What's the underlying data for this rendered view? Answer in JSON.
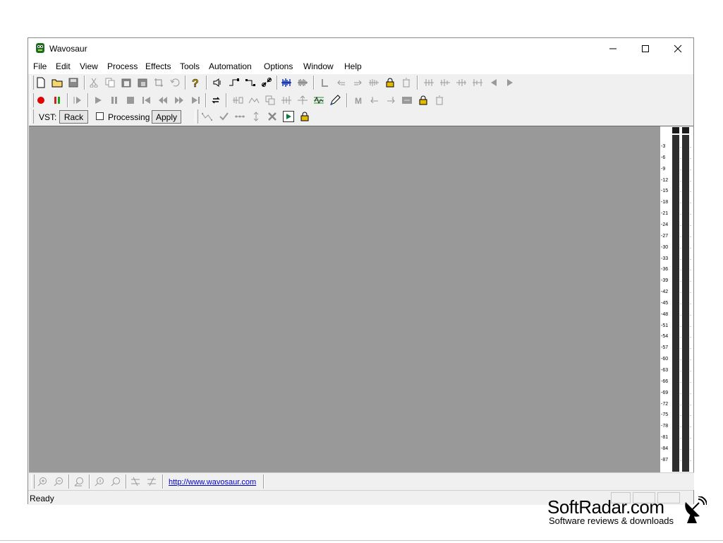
{
  "window": {
    "title": "Wavosaur"
  },
  "menu": [
    "File",
    "Edit",
    "View",
    "Process",
    "Effects",
    "Tools",
    "Automation",
    "Options",
    "Window",
    "Help"
  ],
  "vst": {
    "label": "VST:",
    "rack_button": "Rack",
    "processing_label": "Processing",
    "processing_checked": false,
    "apply_button": "Apply"
  },
  "meter": {
    "ticks": [
      "-3",
      "-6",
      "-9",
      "-12",
      "-15",
      "-18",
      "-21",
      "-24",
      "-27",
      "-30",
      "-33",
      "-36",
      "-39",
      "-42",
      "-45",
      "-48",
      "-51",
      "-54",
      "-57",
      "-60",
      "-63",
      "-66",
      "-69",
      "-72",
      "-75",
      "-78",
      "-81",
      "-84",
      "-87"
    ]
  },
  "zoombar": {
    "link": "http://www.wavosaur.com"
  },
  "status": {
    "text": "Ready"
  },
  "watermark": {
    "title": "SoftRadar.com",
    "subtitle": "Software reviews & downloads"
  },
  "colors": {
    "canvas": "#999999",
    "meter_bar": "#2e2e2e",
    "record": "#e00000",
    "link": "#0000cc"
  }
}
